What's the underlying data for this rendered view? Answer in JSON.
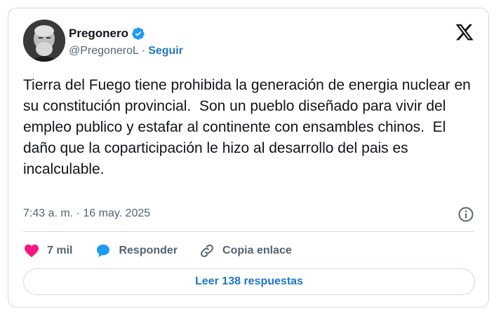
{
  "user": {
    "name": "Pregonero",
    "handle": "@PregoneroL",
    "separator": "·",
    "follow_label": "Seguir"
  },
  "tweet": {
    "text": "Tierra del Fuego tiene prohibida la generación de energia nuclear en su constitución provincial.  Son un pueblo diseñado para vivir del empleo publico y estafar al continente con ensambles chinos.  El daño que la coparticipación le hizo al desarrollo del pais es incalculable.",
    "timestamp": "7:43 a. m. · 16 may. 2025"
  },
  "actions": {
    "like_count": "7 mil",
    "reply_label": "Responder",
    "copy_label": "Copia enlace"
  },
  "replies_button_label": "Leer 138 respuestas",
  "colors": {
    "accent": "#1d76c8",
    "like": "#f91880",
    "verified": "#1d9bf0",
    "muted": "#536471",
    "border": "#cfd9de"
  },
  "icons": [
    "verified-badge-icon",
    "x-logo-icon",
    "info-icon",
    "heart-icon",
    "reply-bubble-icon",
    "link-icon"
  ]
}
